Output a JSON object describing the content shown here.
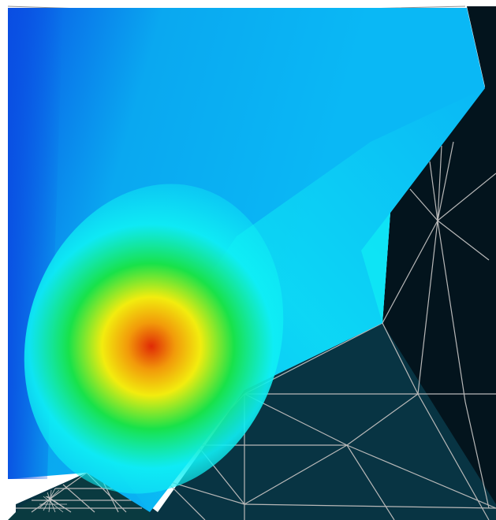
{
  "viewport": {
    "background": "#ffffff",
    "colors": {
      "mesh_dark": "#03141d",
      "mesh_teal": "#083443",
      "mesh_lines": "#b8b8b8",
      "cool_blue": "#0a54e6",
      "field_blue": "#0aa8f0",
      "field_cyan": "#0ff0f5",
      "field_green": "#18e24a",
      "field_yellow": "#f2ec0e",
      "field_orange": "#f29a0a",
      "field_red": "#e02a06"
    },
    "icons": {
      "surface": "contour-surface-icon",
      "mesh": "triangle-mesh-icon"
    }
  }
}
